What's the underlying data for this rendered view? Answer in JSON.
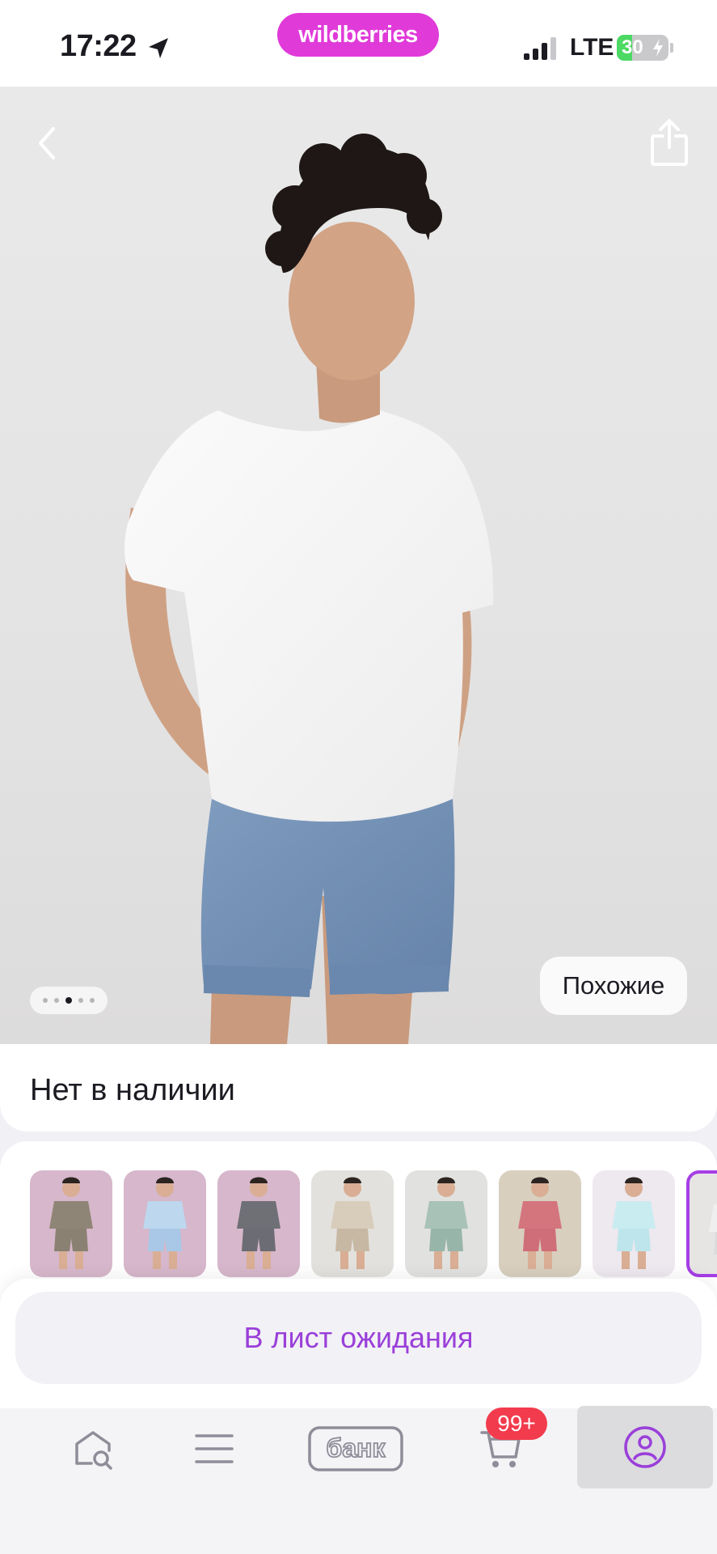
{
  "status_bar": {
    "time": "17:22",
    "network": "LTE",
    "battery_percent": 30,
    "battery_label": "30"
  },
  "brand": {
    "logo_text": "wildberries",
    "color": "#e03ad9"
  },
  "product": {
    "gallery": {
      "current_index": 3,
      "total": 5
    },
    "similar_label": "Похожие",
    "availability": "Нет в наличии",
    "variants_count": 8,
    "selected_variant": 8
  },
  "actions": {
    "waitlist_label": "В лист ожидания",
    "accent": "#9a3fd9"
  },
  "tab_bar": {
    "items": [
      {
        "icon": "home-search-icon"
      },
      {
        "icon": "menu-icon"
      },
      {
        "icon": "bank-icon",
        "label": "банк"
      },
      {
        "icon": "cart-icon",
        "badge": "99+"
      },
      {
        "icon": "profile-icon",
        "active": true
      }
    ]
  }
}
